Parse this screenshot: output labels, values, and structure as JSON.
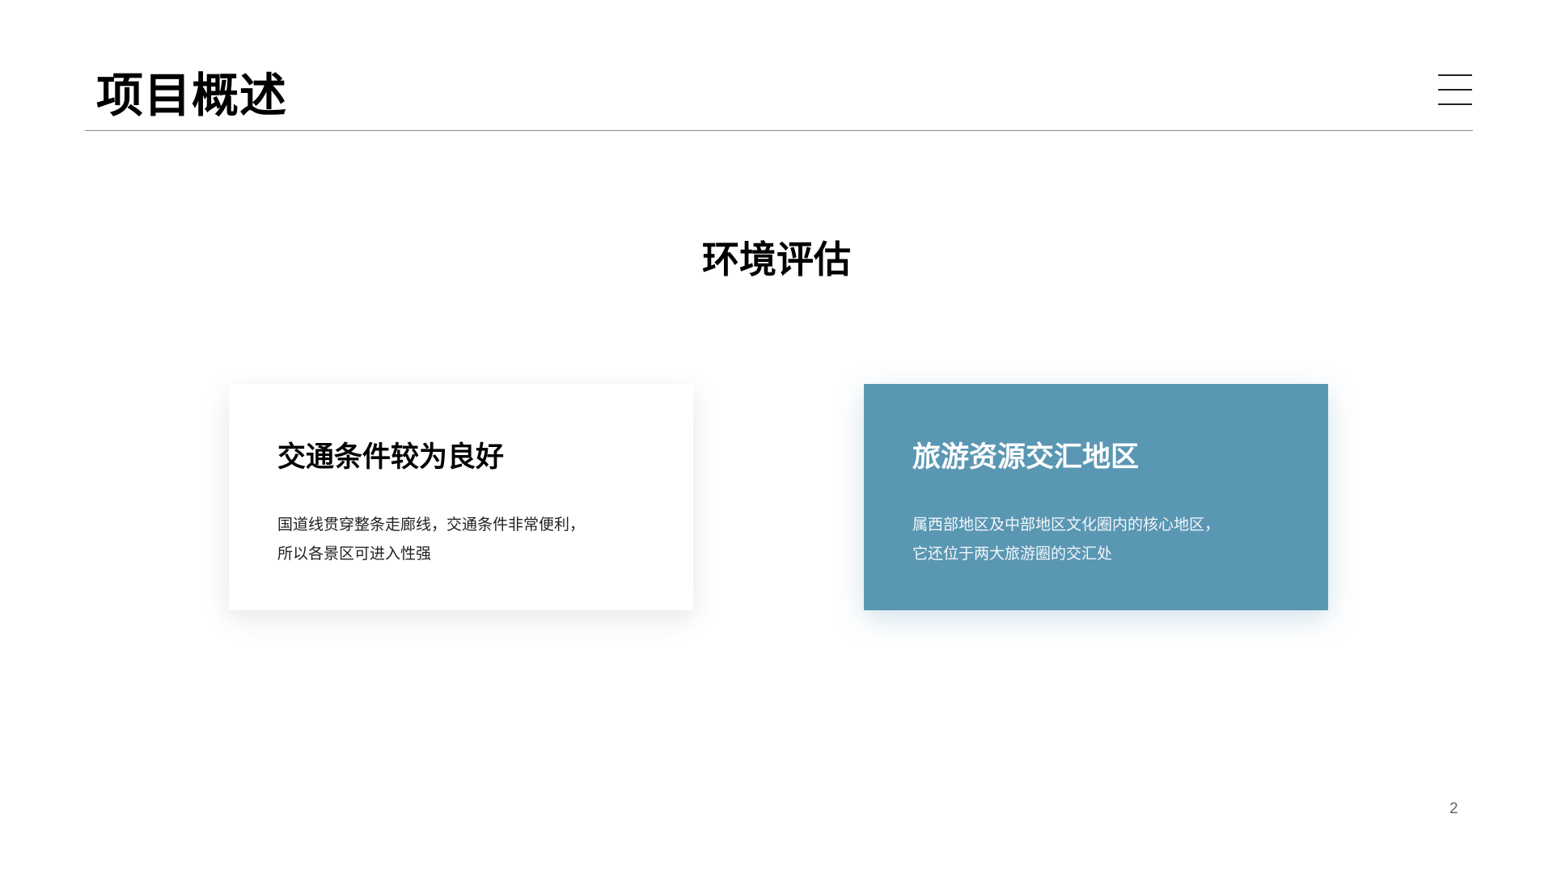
{
  "header": {
    "title": "项目概述"
  },
  "section": {
    "title": "环境评估"
  },
  "cards": [
    {
      "title": "交通条件较为良好",
      "lines": [
        "国道线贯穿整条走廊线，交通条件非常便利，",
        "所以各景区可进入性强"
      ]
    },
    {
      "title": "旅游资源交汇地区",
      "lines": [
        "属西部地区及中部地区文化圈内的核心地区，",
        "它还位于两大旅游圈的交汇处"
      ]
    }
  ],
  "footer": {
    "page_number": "2"
  },
  "colors": {
    "accent": "#5a97b3",
    "title_text": "#000000",
    "rule": "#8a8a8a"
  },
  "icons": {
    "menu": "hamburger-menu-icon"
  }
}
